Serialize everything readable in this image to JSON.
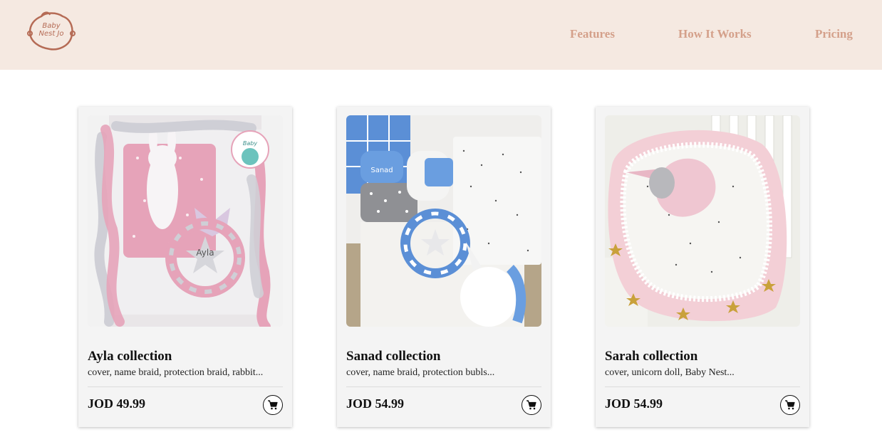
{
  "brand": {
    "logo_text_line1": "Baby",
    "logo_text_line2": "Nest Jo",
    "color": "#b56b55"
  },
  "nav": {
    "items": [
      {
        "label": "Features"
      },
      {
        "label": "How It Works"
      },
      {
        "label": "Pricing"
      }
    ],
    "color": "#d4a08a"
  },
  "products": [
    {
      "title": "Ayla collection",
      "description": "cover, name braid, protection braid, rabbit...",
      "price": "JOD 49.99",
      "image_theme": "pink-grey braided crib set with rabbit doll",
      "cart_icon": "cart-icon"
    },
    {
      "title": "Sanad collection",
      "description": "cover, name braid, protection bubls...",
      "price": "JOD 54.99",
      "image_theme": "blue-grey crib set with unicorn",
      "cart_icon": "cart-icon"
    },
    {
      "title": "Sarah collection",
      "description": "cover, unicorn doll, Baby Nest...",
      "price": "JOD 54.99",
      "image_theme": "pink baby nest with unicorn doll",
      "cart_icon": "cart-icon"
    }
  ],
  "colors": {
    "header_bg": "#f5e9e1",
    "card_bg": "#f4f4f4"
  }
}
